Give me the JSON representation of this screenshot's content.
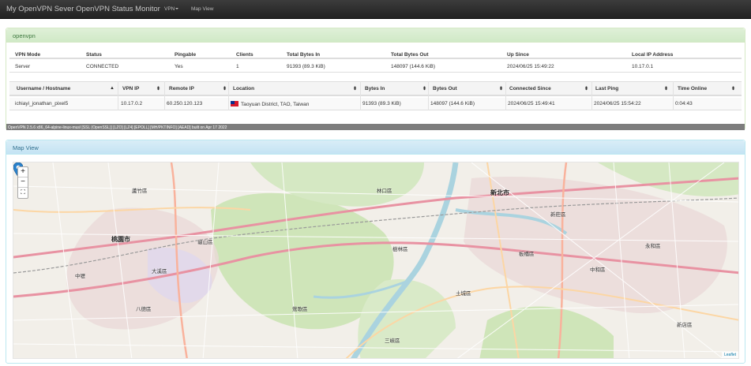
{
  "nav": {
    "brand": "My OpenVPN Sever OpenVPN Status Monitor",
    "vpn_menu": "VPN",
    "map_view": "Map View"
  },
  "vpn_panel": {
    "title": "openvpn",
    "summary_headers": [
      "VPN Mode",
      "Status",
      "Pingable",
      "Clients",
      "Total Bytes In",
      "Total Bytes Out",
      "Up Since",
      "Local IP Address"
    ],
    "summary_values": [
      "Server",
      "CONNECTED",
      "Yes",
      "1",
      "91393 (89.3 KiB)",
      "148097 (144.6 KiB)",
      "2024/06/25 15:49:22",
      "10.17.0.1"
    ],
    "client_headers": [
      "Username / Hostname",
      "VPN IP",
      "Remote IP",
      "Location",
      "Bytes In",
      "Bytes Out",
      "Connected Since",
      "Last Ping",
      "Time Online"
    ],
    "client_row": {
      "username": "ichiayi_jonathan_pixel5",
      "vpn_ip": "10.17.0.2",
      "remote_ip": "60.250.120.123",
      "location": "Taoyuan District, TAO, Taiwan",
      "bytes_in": "91393 (89.3 KiB)",
      "bytes_out": "148097 (144.6 KiB)",
      "connected_since": "2024/06/25 15:49:41",
      "last_ping": "2024/06/25 15:54:22",
      "time_online": "0:04:43"
    },
    "footer": "OpenVPN 2.5.6 x86_64-alpine-linux-musl [SSL (OpenSSL)] [LZO] [LZ4] [EPOLL] [MH/PKTINFO] [AEAD] built on Apr 17 2022"
  },
  "map_panel": {
    "title": "Map View",
    "zoom_in": "+",
    "zoom_out": "−",
    "fullscreen": "⛶",
    "attribution": "Leaflet",
    "labels": {
      "taoyuan": "桃園市",
      "new_taipei": "新北市",
      "guishan": "龜山區",
      "yingge": "鶯歌區",
      "shulin": "樹林區",
      "tucheng": "土城區",
      "banqiao": "板橋區",
      "zhonghe": "中和區",
      "yonghe": "永和區",
      "daxi": "大溪區",
      "bade": "八德區",
      "zhongli": "中壢",
      "sanxia": "三峽區",
      "xinzhuang": "新莊區",
      "luzhu": "蘆竹區",
      "linkou": "林口區",
      "xindian": "新店區"
    }
  },
  "colors": {
    "panel_green": "#dff0d8",
    "panel_blue": "#d9edf7",
    "marker": "#2a81cb"
  }
}
